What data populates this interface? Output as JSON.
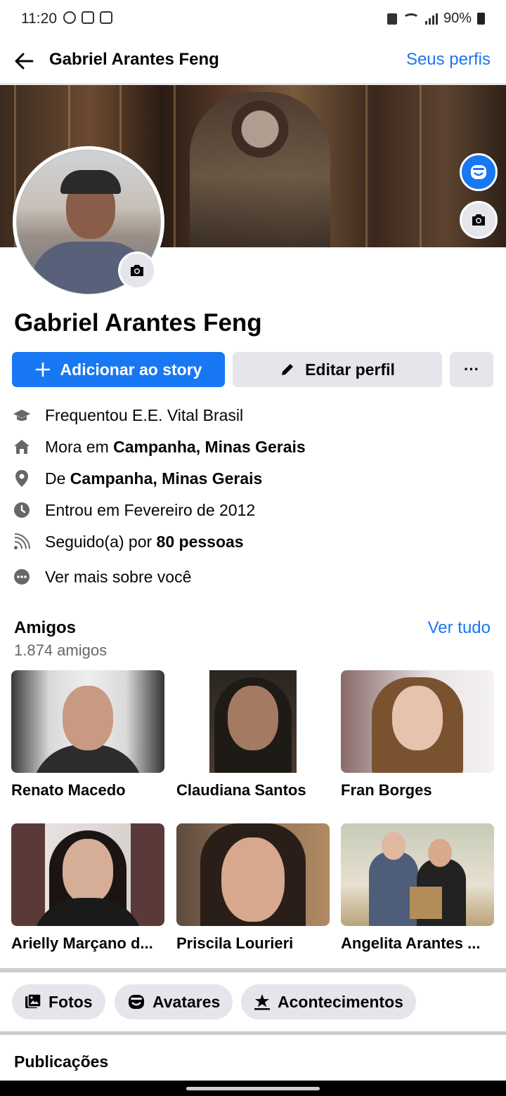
{
  "status_bar": {
    "time": "11:20",
    "battery": "90%"
  },
  "header": {
    "title": "Gabriel Arantes Feng",
    "profiles_link": "Seus perfis"
  },
  "profile": {
    "name": "Gabriel Arantes Feng"
  },
  "actions": {
    "add_story": "Adicionar ao story",
    "edit_profile": "Editar perfil",
    "more": "···"
  },
  "details": {
    "school": {
      "prefix": "Frequentou E.E. Vital Brasil"
    },
    "lives": {
      "prefix": "Mora em ",
      "value": "Campanha, Minas Gerais"
    },
    "from": {
      "prefix": "De ",
      "value": "Campanha, Minas Gerais"
    },
    "joined": {
      "prefix": "Entrou em Fevereiro de 2012"
    },
    "followers": {
      "prefix": "Seguido(a) por ",
      "value": "80 pessoas"
    },
    "see_more": "Ver mais sobre você"
  },
  "friends": {
    "title": "Amigos",
    "count": "1.874 amigos",
    "see_all": "Ver tudo",
    "list": [
      {
        "name": "Renato Macedo"
      },
      {
        "name": "Claudiana Santos"
      },
      {
        "name": "Fran Borges"
      },
      {
        "name": "Arielly Marçano d..."
      },
      {
        "name": "Priscila Lourieri"
      },
      {
        "name": "Angelita Arantes ..."
      }
    ]
  },
  "tabs": {
    "photos": "Fotos",
    "avatars": "Avatares",
    "events": "Acontecimentos"
  },
  "posts": {
    "title": "Publicações"
  },
  "colors": {
    "accent": "#1877f2",
    "chip_bg": "#e4e6eb",
    "text": "#050505",
    "secondary": "#65676b"
  }
}
